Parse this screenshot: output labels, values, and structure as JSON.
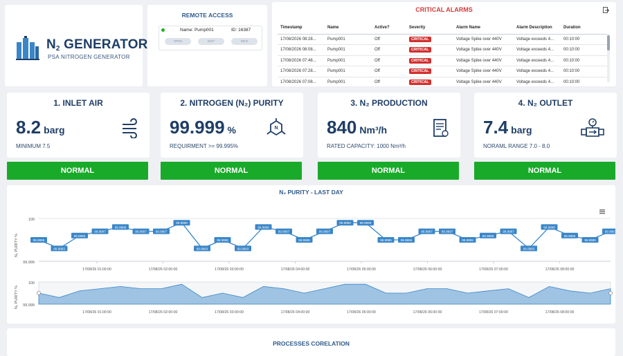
{
  "logo": {
    "brand_main": "N",
    "brand_sub": "2",
    "brand_rest": " GENERATOR",
    "tagline": "PSA NITROGEN GENERATOR"
  },
  "remote_access": {
    "title": "REMOTE ACCESS",
    "device": {
      "name_text": "Name: Pump001",
      "id_text": "ID: 16387",
      "status_color": "#20b02a"
    },
    "buttons": [
      "OPEN",
      "EDIT",
      "INFO"
    ]
  },
  "alarms": {
    "title": "CRITICAL ALARMS",
    "columns": [
      "Timestamp",
      "Name",
      "Active?",
      "Severity",
      "Alarm Name",
      "Alarm Description",
      "Duration"
    ],
    "rows": [
      [
        "17/08/2026 08:28...",
        "Pump001",
        "Off",
        "CRITICAL",
        "Voltage Spike over 440V",
        "Voltage exceeds 4...",
        "00:10:00"
      ],
      [
        "17/08/2026 08:08...",
        "Pump001",
        "Off",
        "CRITICAL",
        "Voltage Spike over 440V",
        "Voltage exceeds 4...",
        "00:10:00"
      ],
      [
        "17/08/2026 07:48...",
        "Pump001",
        "Off",
        "CRITICAL",
        "Voltage Spike over 440V",
        "Voltage exceeds 4...",
        "00:10:00"
      ],
      [
        "17/08/2026 07:28...",
        "Pump001",
        "Off",
        "CRITICAL",
        "Voltage Spike over 440V",
        "Voltage exceeds 4...",
        "00:10:00"
      ],
      [
        "17/08/2026 07:08...",
        "Pump001",
        "Off",
        "CRITICAL",
        "Voltage Spike over 440V",
        "Voltage exceeds 4...",
        "00:10:00"
      ]
    ],
    "severity_color": "#d32f2f"
  },
  "kpis": [
    {
      "title": "1. INLET AIR",
      "value": "8.2",
      "unit": "barg",
      "sub": "MINIMUM 7.5",
      "status": "NORMAL",
      "icon": "airflow-icon"
    },
    {
      "title": "2. NITROGEN (N₂) PURITY",
      "value": "99.999",
      "unit": "%",
      "sub": "REQUIRMENT >= 99.995%",
      "status": "NORMAL",
      "icon": "molecule-icon"
    },
    {
      "title": "3. N₂ PRODUCTION",
      "value": "840",
      "unit": "Nm³/h",
      "sub": "RATED CAPACITY: 1000 Nm³/h",
      "status": "NORMAL",
      "icon": "document-icon"
    },
    {
      "title": "4. N₂ OUTLET",
      "value": "7.4",
      "unit": "barg",
      "sub": "NORAML RANGE 7.0 - 8.0",
      "status": "NORMAL",
      "icon": "flow-meter-icon"
    }
  ],
  "status_color": "#1aaa2a",
  "process_title": "PROCESSES CORELATION",
  "chart_data": {
    "type": "line",
    "title": "N₂ PURITY - LAST DAY",
    "ylabel": "N₂ PURITY %",
    "ylim": [
      99.999,
      100
    ],
    "y_ticks": [
      "100",
      "99.999"
    ],
    "x_ticks": [
      "17/08/26 01:00:00",
      "17/08/26 02:00:00",
      "17/08/26 03:00:00",
      "17/08/26 04:00:00",
      "17/08/26 05:00:00",
      "17/08/26 06:00:00",
      "17/08/26 07:00:00",
      "17/08/26 08:00:00"
    ],
    "navigator_y_ticks": [
      "100",
      "99.999"
    ],
    "navigator_x_ticks": [
      "17/08/26 01:00:00",
      "17/08/26 02:00:00",
      "17/08/26 03:00:00",
      "17/08/26 04:00:00",
      "17/08/26 05:00:00",
      "17/08/26 06:00:00",
      "17/08/26 07:00:00",
      "17/08/26 08:00:00"
    ],
    "series": [
      {
        "values": [
          99.9995,
          99.9993,
          99.9996,
          99.9997,
          99.9998,
          99.9997,
          99.9997,
          99.9999,
          99.9993,
          99.9995,
          99.9993,
          99.9998,
          99.9997,
          99.9995,
          99.9997,
          99.9999,
          99.9999,
          99.9995,
          99.9995,
          99.9997,
          99.9997,
          99.9995,
          99.9996,
          99.9997,
          99.9993,
          99.9998,
          99.9996,
          99.9995,
          99.9997
        ]
      }
    ],
    "grid": true,
    "legend": "none",
    "line_color": "#3a86c8"
  }
}
